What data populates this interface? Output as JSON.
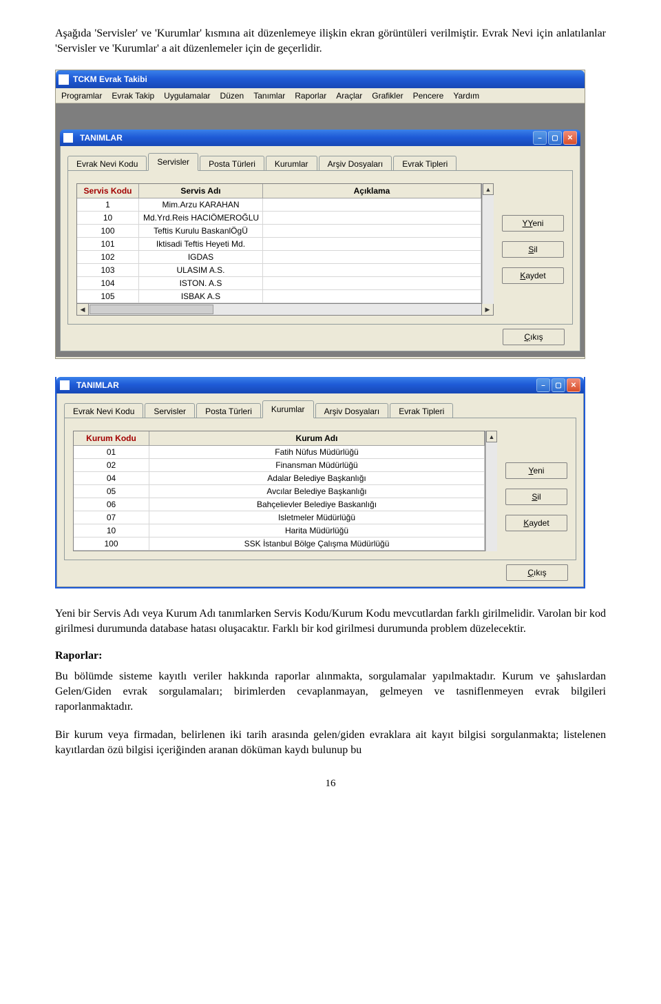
{
  "doc": {
    "intro": "Aşağıda 'Servisler' ve 'Kurumlar' kısmına ait düzenlemeye ilişkin ekran görüntüleri verilmiştir. Evrak Nevi için anlatılanlar 'Servisler ve 'Kurumlar' a ait düzenlemeler için de geçerlidir.",
    "para1": "Yeni bir Servis Adı veya Kurum Adı tanımlarken Servis Kodu/Kurum Kodu mevcutlardan farklı girilmelidir. Varolan bir kod girilmesi durumunda database hatası oluşacaktır. Farklı bir kod girilmesi durumunda problem düzelecektir.",
    "heading": "Raporlar:",
    "para2": "Bu bölümde sisteme kayıtlı veriler hakkında raporlar alınmakta, sorgulamalar yapılmaktadır. Kurum ve şahıslardan Gelen/Giden evrak sorgulamaları; birimlerden cevaplanmayan, gelmeyen ve tasniflenmeyen evrak bilgileri raporlanmaktadır.",
    "para3": "Bir kurum veya firmadan, belirlenen iki tarih arasında gelen/giden evraklara ait kayıt bilgisi sorgulanmakta; listelenen kayıtlardan özü bilgisi içeriğinden aranan döküman kaydı bulunup bu",
    "pagenum": "16"
  },
  "app": {
    "title": "TCKM Evrak Takibi",
    "menus": [
      "Programlar",
      "Evrak Takip",
      "Uygulamalar",
      "Düzen",
      "Tanımlar",
      "Raporlar",
      "Araçlar",
      "Grafikler",
      "Pencere",
      "Yardım"
    ]
  },
  "child": {
    "title": "TANIMLAR",
    "tabs": [
      "Evrak Nevi Kodu",
      "Servisler",
      "Posta Türleri",
      "Kurumlar",
      "Arşiv Dosyaları",
      "Evrak Tipleri"
    ],
    "buttons": {
      "yeni": "Yeni",
      "sil": "Sil",
      "kaydet": "Kaydet",
      "cikis": "Çıkış"
    }
  },
  "grid1": {
    "headers": [
      "Servis Kodu",
      "Servis Adı",
      "Açıklama"
    ],
    "rows": [
      [
        "1",
        "Mim.Arzu KARAHAN",
        ""
      ],
      [
        "10",
        "Md.Yrd.Reis HACIÖMEROĞLU",
        ""
      ],
      [
        "100",
        "Teftis Kurulu BaskanlÖgÜ",
        ""
      ],
      [
        "101",
        "Iktisadi Teftis Heyeti Md.",
        ""
      ],
      [
        "102",
        "IGDAS",
        ""
      ],
      [
        "103",
        "ULASIM A.S.",
        ""
      ],
      [
        "104",
        "ISTON. A.S",
        ""
      ],
      [
        "105",
        "ISBAK A.S",
        ""
      ]
    ]
  },
  "grid2": {
    "headers": [
      "Kurum Kodu",
      "Kurum Adı"
    ],
    "rows": [
      [
        "01",
        "Fatih Nüfus Müdürlüğü"
      ],
      [
        "02",
        "Finansman Müdürlüğü"
      ],
      [
        "04",
        "Adalar  Belediye Başkanlığı"
      ],
      [
        "05",
        "Avcılar Belediye Başkanlığı"
      ],
      [
        "06",
        "Bahçelievler Belediye Baskanlığı"
      ],
      [
        "07",
        "Isletmeler Müdürlüğü"
      ],
      [
        "10",
        "Harita Müdürlüğü"
      ],
      [
        "100",
        "SSK İstanbul Bölge Çalışma Müdürlüğü"
      ]
    ]
  }
}
